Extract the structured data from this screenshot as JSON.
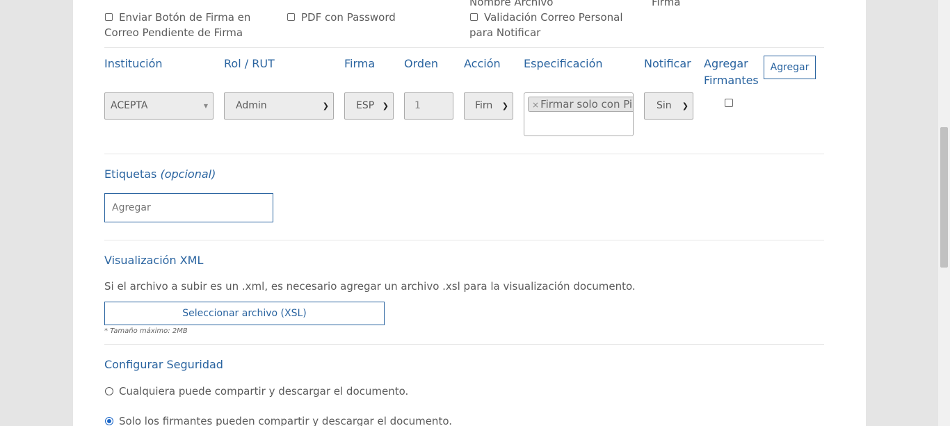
{
  "options": {
    "partial_top_left": "Nombre Archivo",
    "partial_top_right": "Firma",
    "send_button_email": "Enviar Botón de Firma en Correo Pendiente de Firma",
    "pdf_password": "PDF con Password",
    "validate_email": "Validación Correo Personal para Notificar"
  },
  "signers": {
    "headers": {
      "institucion": "Institución",
      "rol_rut": "Rol / RUT",
      "firma": "Firma",
      "orden": "Orden",
      "accion": "Acción",
      "especificacion": "Especificación",
      "notificar": "Notificar",
      "agregar_firmantes": "Agregar Firmantes"
    },
    "add_button": "Agregar",
    "institucion_value": "ACEPTA",
    "rol_value": "Admin",
    "firma_value": "ESP",
    "orden_value": "1",
    "accion_value": "Firn",
    "especificacion_tag": "Firmar solo con Pin",
    "tag_remove": "×",
    "notificar_value": "Sin"
  },
  "tags": {
    "title": "Etiquetas",
    "optional": "(opcional)",
    "input_placeholder": "Agregar"
  },
  "xml": {
    "title": "Visualización XML",
    "description": "Si el archivo a subir es un .xml, es necesario agregar un archivo .xsl para la visualización documento.",
    "file_button": "Seleccionar archivo (XSL)",
    "max_size_note": "* Tamaño máximo: 2MB"
  },
  "security": {
    "title": "Configurar Seguridad",
    "option_anyone": "Cualquiera puede compartir y descargar el documento.",
    "option_signers": "Solo los firmantes pueden compartir y descargar el documento."
  }
}
